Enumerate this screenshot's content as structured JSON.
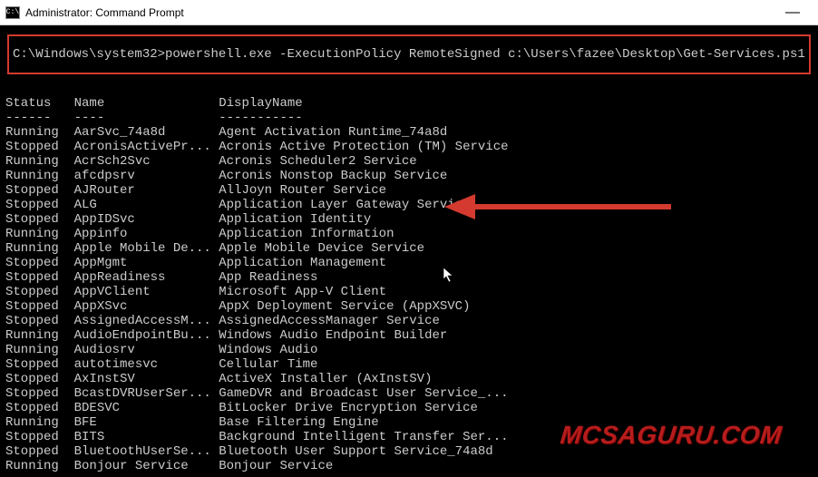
{
  "titlebar": {
    "icon_label": "C:\\",
    "text": "Administrator: Command Prompt",
    "minimize": "—"
  },
  "command": {
    "prompt": "C:\\Windows\\system32>",
    "cmd": "powershell.exe -ExecutionPolicy RemoteSigned c:\\Users\\fazee\\Desktop\\Get-Services.ps1"
  },
  "header": {
    "status": "Status",
    "name": "Name",
    "display": "DisplayName",
    "sep_status": "------",
    "sep_name": "----",
    "sep_display": "-----------"
  },
  "rows": [
    {
      "status": "Running",
      "name": "AarSvc_74a8d",
      "display": "Agent Activation Runtime_74a8d"
    },
    {
      "status": "Stopped",
      "name": "AcronisActivePr...",
      "display": "Acronis Active Protection (TM) Service"
    },
    {
      "status": "Running",
      "name": "AcrSch2Svc",
      "display": "Acronis Scheduler2 Service"
    },
    {
      "status": "Running",
      "name": "afcdpsrv",
      "display": "Acronis Nonstop Backup Service"
    },
    {
      "status": "Stopped",
      "name": "AJRouter",
      "display": "AllJoyn Router Service"
    },
    {
      "status": "Stopped",
      "name": "ALG",
      "display": "Application Layer Gateway Service"
    },
    {
      "status": "Stopped",
      "name": "AppIDSvc",
      "display": "Application Identity"
    },
    {
      "status": "Running",
      "name": "Appinfo",
      "display": "Application Information"
    },
    {
      "status": "Running",
      "name": "Apple Mobile De...",
      "display": "Apple Mobile Device Service"
    },
    {
      "status": "Stopped",
      "name": "AppMgmt",
      "display": "Application Management"
    },
    {
      "status": "Stopped",
      "name": "AppReadiness",
      "display": "App Readiness"
    },
    {
      "status": "Stopped",
      "name": "AppVClient",
      "display": "Microsoft App-V Client"
    },
    {
      "status": "Stopped",
      "name": "AppXSvc",
      "display": "AppX Deployment Service (AppXSVC)"
    },
    {
      "status": "Stopped",
      "name": "AssignedAccessM...",
      "display": "AssignedAccessManager Service"
    },
    {
      "status": "Running",
      "name": "AudioEndpointBu...",
      "display": "Windows Audio Endpoint Builder"
    },
    {
      "status": "Running",
      "name": "Audiosrv",
      "display": "Windows Audio"
    },
    {
      "status": "Stopped",
      "name": "autotimesvc",
      "display": "Cellular Time"
    },
    {
      "status": "Stopped",
      "name": "AxInstSV",
      "display": "ActiveX Installer (AxInstSV)"
    },
    {
      "status": "Stopped",
      "name": "BcastDVRUserSer...",
      "display": "GameDVR and Broadcast User Service_..."
    },
    {
      "status": "Stopped",
      "name": "BDESVC",
      "display": "BitLocker Drive Encryption Service"
    },
    {
      "status": "Running",
      "name": "BFE",
      "display": "Base Filtering Engine"
    },
    {
      "status": "Stopped",
      "name": "BITS",
      "display": "Background Intelligent Transfer Ser..."
    },
    {
      "status": "Stopped",
      "name": "BluetoothUserSe...",
      "display": "Bluetooth User Support Service_74a8d"
    },
    {
      "status": "Running",
      "name": "Bonjour Service",
      "display": "Bonjour Service"
    }
  ],
  "watermark": "MCSAGURU.COM"
}
